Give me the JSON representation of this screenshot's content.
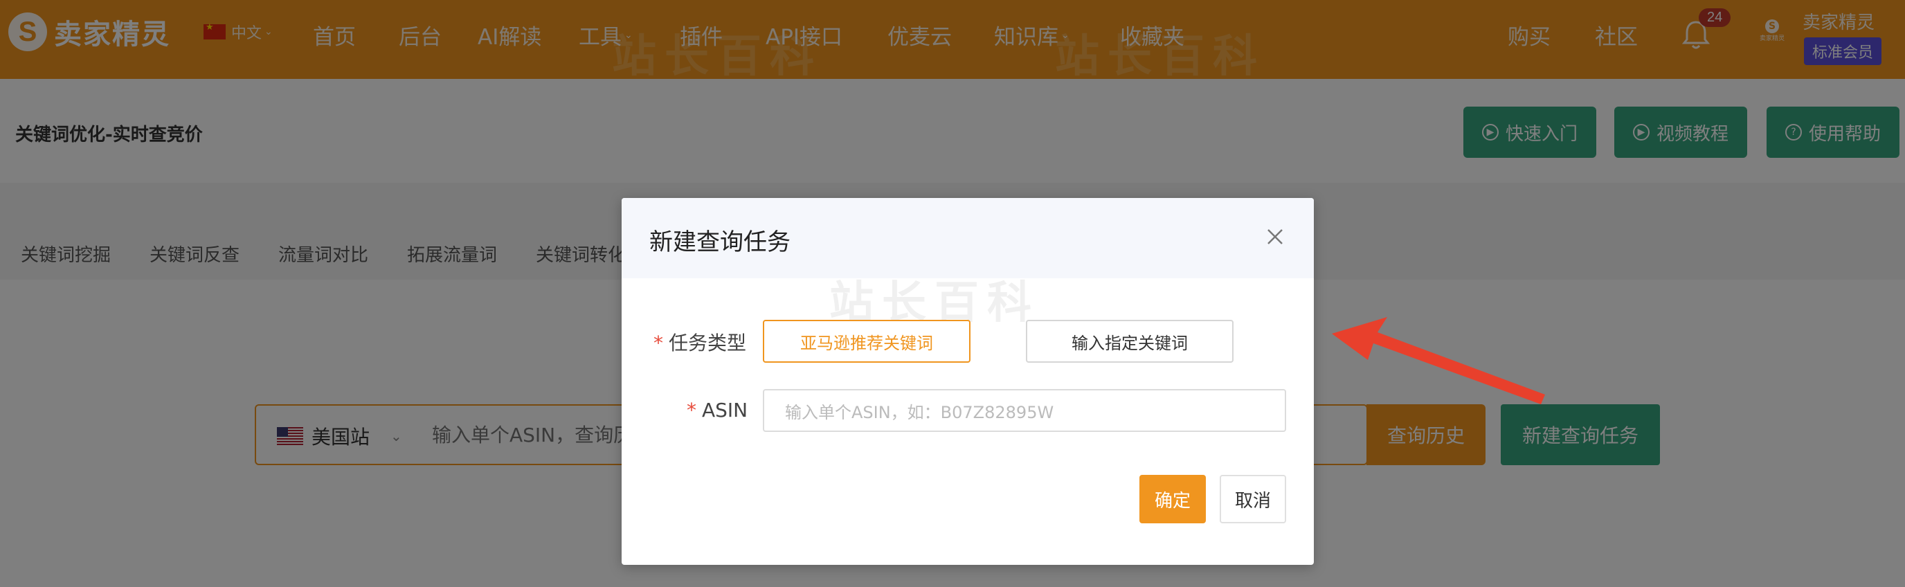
{
  "brand": {
    "logo_letter": "S",
    "name": "卖家精灵"
  },
  "language": {
    "label": "中文"
  },
  "nav": [
    {
      "label": "首页"
    },
    {
      "label": "后台"
    },
    {
      "label": "AI解读"
    },
    {
      "label": "工具"
    },
    {
      "label": "插件"
    },
    {
      "label": "API接口"
    },
    {
      "label": "优麦云"
    },
    {
      "label": "知识库"
    },
    {
      "label": "收藏夹"
    }
  ],
  "nav_right": {
    "buy": "购买",
    "community": "社区",
    "notifications": "24"
  },
  "user": {
    "name": "卖家精灵",
    "membership": "标准会员",
    "mini_logo_text": "卖家精灵"
  },
  "page": {
    "title": "关键词优化-实时查竞价",
    "help_buttons": [
      {
        "label": "快速入门"
      },
      {
        "label": "视频教程"
      },
      {
        "label": "使用帮助"
      }
    ],
    "tabs": [
      {
        "label": "关键词挖掘"
      },
      {
        "label": "关键词反查"
      },
      {
        "label": "流量词对比"
      },
      {
        "label": "拓展流量词"
      },
      {
        "label": "关键词转化"
      }
    ]
  },
  "search": {
    "site": "美国站",
    "placeholder": "输入单个ASIN，查询历",
    "history_button": "查询历史",
    "new_task_button": "新建查询任务"
  },
  "modal": {
    "title": "新建查询任务",
    "task_type_label": "任务类型",
    "task_type_options": [
      {
        "label": "亚马逊推荐关键词",
        "selected": true
      },
      {
        "label": "输入指定关键词",
        "selected": false
      }
    ],
    "asin_label": "ASIN",
    "asin_placeholder": "输入单个ASIN，如：B07Z82895W",
    "confirm_button": "确定",
    "cancel_button": "取消"
  },
  "watermark_text": "站长百科",
  "colors": {
    "brand_orange": "#f0951f",
    "green": "#36a57e",
    "member_purple": "#5b4fd8",
    "badge_red": "#c0392b",
    "arrow_red": "#e8402c"
  }
}
